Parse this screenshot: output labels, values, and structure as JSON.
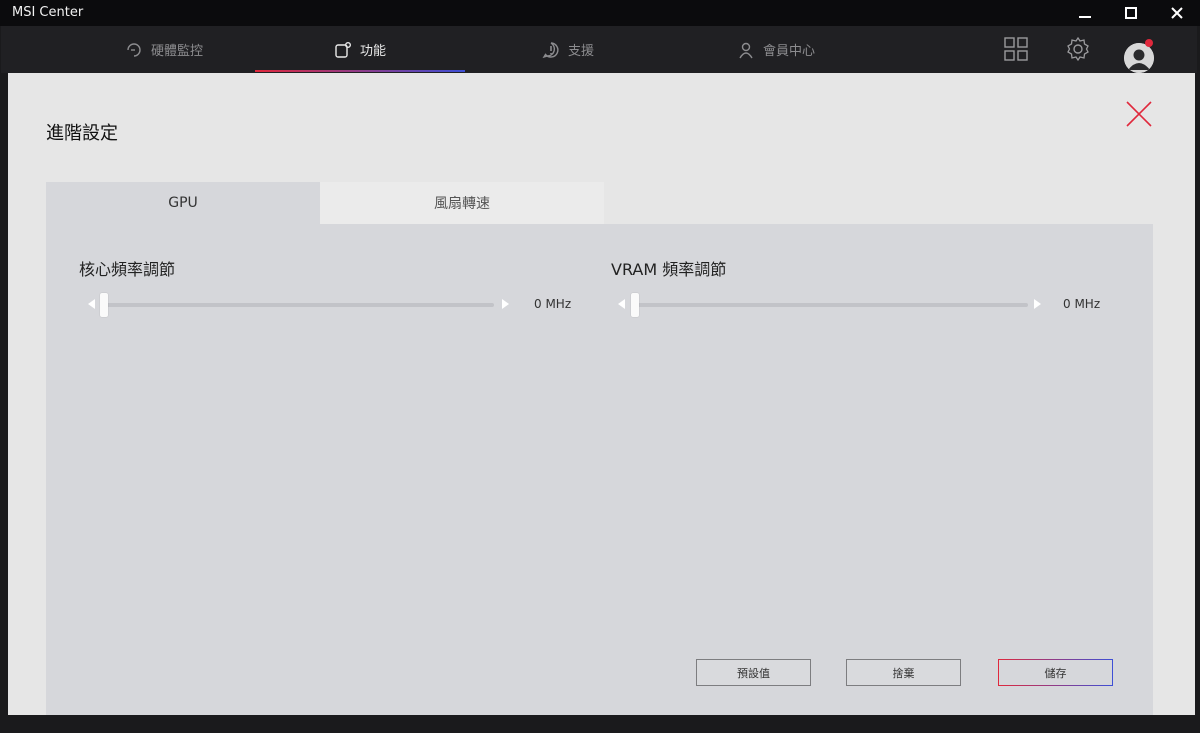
{
  "window": {
    "title": "MSI Center"
  },
  "nav": {
    "items": [
      {
        "label": "硬體監控",
        "icon": "gauge-icon"
      },
      {
        "label": "功能",
        "icon": "feature-icon"
      },
      {
        "label": "支援",
        "icon": "support-icon"
      },
      {
        "label": "會員中心",
        "icon": "user-icon"
      }
    ],
    "active": "功能"
  },
  "dialog": {
    "title": "進階設定",
    "tabs": [
      {
        "label": "GPU"
      },
      {
        "label": "風扇轉速"
      }
    ],
    "active_tab": "GPU",
    "core_clock": {
      "label": "核心頻率調節",
      "value": "0 MHz"
    },
    "vram_clock": {
      "label": "VRAM 頻率調節",
      "value": "0 MHz"
    },
    "buttons": {
      "default": "預設值",
      "discard": "捨棄",
      "save": "儲存"
    }
  },
  "colors": {
    "accent_red": "#e0283c",
    "accent_blue": "#3d4fd6"
  }
}
